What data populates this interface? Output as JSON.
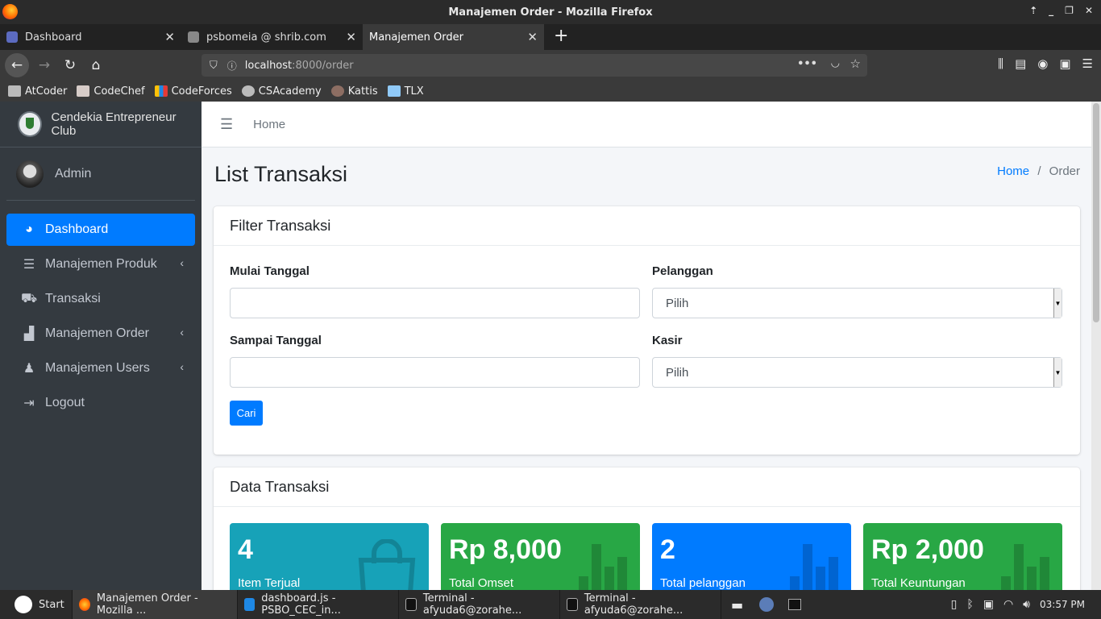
{
  "window": {
    "title": "Manajemen Order - Mozilla Firefox"
  },
  "tabs": [
    {
      "label": "Dashboard"
    },
    {
      "label": "psbomeia @ shrib.com"
    },
    {
      "label": "Manajemen Order"
    }
  ],
  "url": {
    "host": "localhost",
    "path": ":8000/order"
  },
  "bookmarks": [
    "AtCoder",
    "CodeChef",
    "CodeForces",
    "CSAcademy",
    "Kattis",
    "TLX"
  ],
  "brand": {
    "name": "Cendekia Entrepreneur Club"
  },
  "user": {
    "name": "Admin"
  },
  "sidebar": {
    "items": [
      {
        "label": "Dashboard",
        "icon": "tachometer-icon"
      },
      {
        "label": "Manajemen Produk",
        "icon": "server-icon"
      },
      {
        "label": "Transaksi",
        "icon": "cart-icon"
      },
      {
        "label": "Manajemen Order",
        "icon": "shopping-bag-icon"
      },
      {
        "label": "Manajemen Users",
        "icon": "users-icon"
      },
      {
        "label": "Logout",
        "icon": "sign-out-icon"
      }
    ]
  },
  "topnav": {
    "home": "Home"
  },
  "page": {
    "title": "List Transaksi"
  },
  "breadcrumb": {
    "home": "Home",
    "sep": "/",
    "current": "Order"
  },
  "filter": {
    "title": "Filter Transaksi",
    "start_label": "Mulai Tanggal",
    "end_label": "Sampai Tanggal",
    "customer_label": "Pelanggan",
    "customer_value": "Pilih",
    "cashier_label": "Kasir",
    "cashier_value": "Pilih",
    "search_button": "Cari"
  },
  "data": {
    "title": "Data Transaksi",
    "boxes": [
      {
        "value": "4",
        "label": "Item Terjual",
        "color": "#17a2b8"
      },
      {
        "value": "Rp 8,000",
        "label": "Total Omset",
        "color": "#28a745"
      },
      {
        "value": "2",
        "label": "Total pelanggan",
        "color": "#007bff"
      },
      {
        "value": "Rp 2,000",
        "label": "Total Keuntungan",
        "color": "#28a745"
      }
    ]
  },
  "taskbar": {
    "start": "Start",
    "items": [
      "Manajemen Order - Mozilla ...",
      "dashboard.js - PSBO_CEC_in...",
      "Terminal - afyuda6@zorahe...",
      "Terminal - afyuda6@zorahe..."
    ],
    "clock": "03:57 PM"
  }
}
